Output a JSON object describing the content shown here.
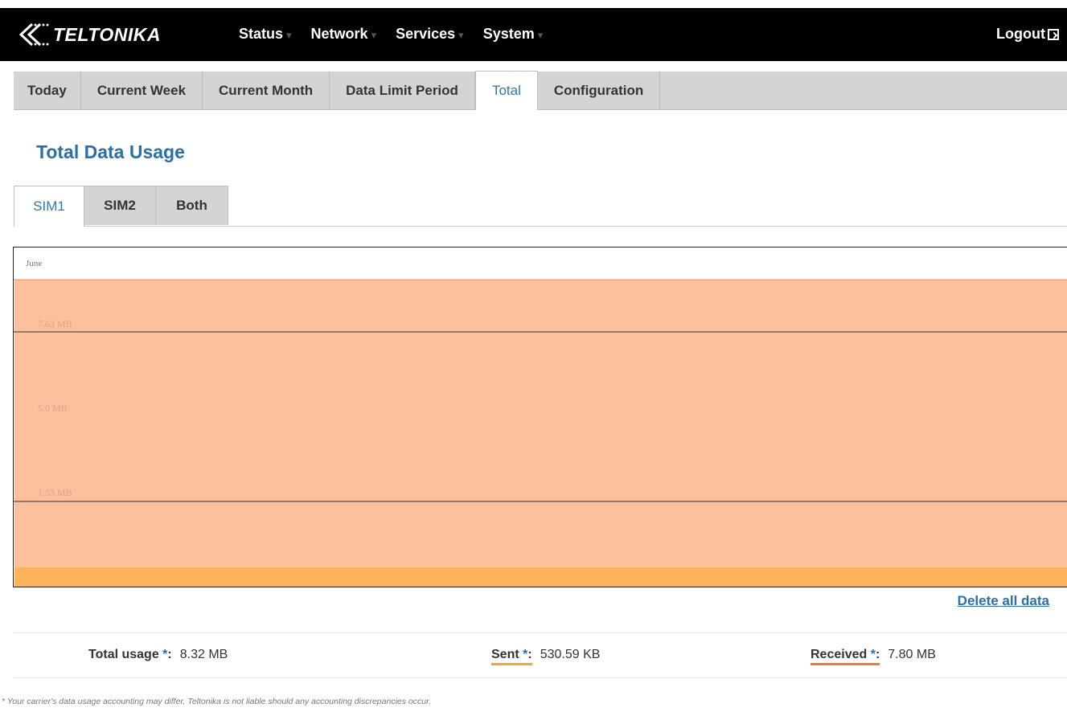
{
  "brand": {
    "name": "TELTONIKA"
  },
  "nav": {
    "items": [
      {
        "label": "Status"
      },
      {
        "label": "Network"
      },
      {
        "label": "Services"
      },
      {
        "label": "System"
      }
    ],
    "logout": "Logout"
  },
  "tabs": [
    {
      "label": "Today"
    },
    {
      "label": "Current Week"
    },
    {
      "label": "Current Month"
    },
    {
      "label": "Data Limit Period"
    },
    {
      "label": "Total",
      "active": true
    },
    {
      "label": "Configuration"
    }
  ],
  "page": {
    "title": "Total Data Usage"
  },
  "subtabs": [
    {
      "label": "SIM1",
      "active": true
    },
    {
      "label": "SIM2"
    },
    {
      "label": "Both"
    }
  ],
  "chart_data": {
    "type": "area",
    "x": [
      "June"
    ],
    "series": [
      {
        "name": "Received",
        "values": [
          7.8
        ],
        "color": "#fcc09c"
      },
      {
        "name": "Sent",
        "values": [
          0.53
        ],
        "color": "#fdb35a"
      }
    ],
    "y_ticks": [
      "7.63 MB",
      "5.0 MB",
      "1.53 MB"
    ],
    "grid": true
  },
  "actions": {
    "delete_all": "Delete all data"
  },
  "summary": {
    "total_label": "Total usage",
    "total_value": "8.32 MB",
    "sent_label": "Sent",
    "sent_value": "530.59 KB",
    "received_label": "Received",
    "received_value": "7.80 MB",
    "required_mark": "*",
    "colon": ":"
  },
  "footnote": "* Your carrier's data usage accounting may differ. Teltonika is not liable should any accounting discrepancies occur.",
  "colors": {
    "accent": "#2a6fa8",
    "received": "#fcc09c",
    "sent": "#fdb35a",
    "sent_underline": "#f3a632",
    "received_underline": "#f47a2a"
  }
}
